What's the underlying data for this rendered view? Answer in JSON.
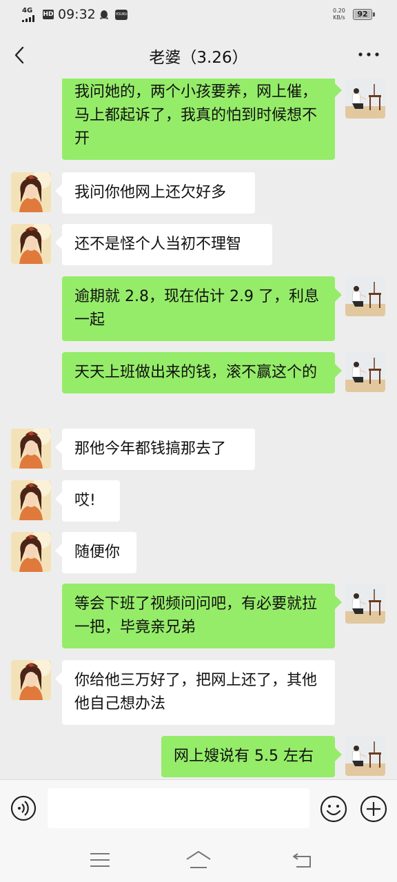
{
  "status_bar": {
    "network": "4G",
    "hd": "HD",
    "time": "09:32",
    "app_badge": "YOUKU",
    "speed_value": "0.20",
    "speed_unit": "KB/s",
    "battery": "92"
  },
  "header": {
    "title": "老婆（3.26）"
  },
  "colors": {
    "background": "#ededed",
    "sent_bubble": "#95ec69",
    "received_bubble": "#ffffff"
  },
  "messages": [
    {
      "side": "right",
      "text": "我问她的，两个小孩要养，网上催，马上都起诉了，我真的怕到时候想不开"
    },
    {
      "side": "left",
      "text": "我问你他网上还欠好多"
    },
    {
      "side": "left",
      "text": "还不是怪个人当初不理智"
    },
    {
      "side": "right",
      "text": "逾期就 2.8，现在估计 2.9 了，利息一起"
    },
    {
      "side": "right",
      "text": "天天上班做出来的钱，滚不赢这个的"
    },
    {
      "side": "left",
      "text": "那他今年都钱搞那去了"
    },
    {
      "side": "left",
      "text": "哎!"
    },
    {
      "side": "left",
      "text": "随便你"
    },
    {
      "side": "right",
      "text": "等会下班了视频问问吧，有必要就拉一把，毕竟亲兄弟"
    },
    {
      "side": "left",
      "text": "你给他三万好了，把网上还了，其他他自己想办法"
    },
    {
      "side": "right",
      "text": "网上嫂说有 5.5 左右"
    }
  ],
  "input_bar": {
    "placeholder": ""
  },
  "icons": {
    "back": "back-arrow-icon",
    "more": "more-dots-icon",
    "voice": "voice-icon",
    "emoji": "emoji-icon",
    "plus": "plus-icon",
    "nav_menu": "menu-icon",
    "nav_home": "home-icon",
    "nav_back": "return-icon"
  }
}
